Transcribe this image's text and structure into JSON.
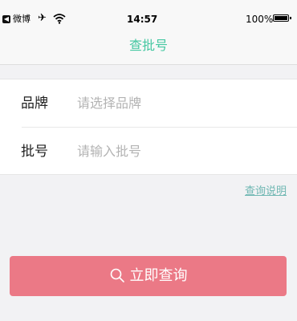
{
  "status_bar": {
    "back_app": "微博",
    "time": "14:57",
    "battery": "100%"
  },
  "nav": {
    "title": "查批号"
  },
  "form": {
    "brand_label": "品牌",
    "brand_placeholder": "请选择品牌",
    "batch_label": "批号",
    "batch_placeholder": "请输入批号"
  },
  "help_link": "查询说明",
  "query_button": {
    "label": "立即查询",
    "icon": "search-icon"
  },
  "colors": {
    "accent": "#44c7a1",
    "button": "#eb7986",
    "link": "#6fb7b2"
  }
}
